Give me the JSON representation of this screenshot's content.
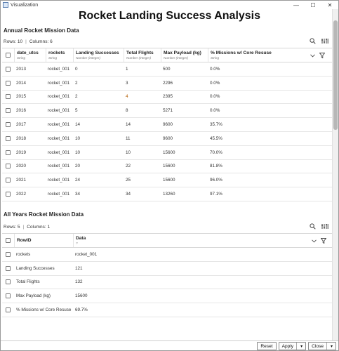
{
  "window": {
    "title": "Visualization",
    "minimize": "—",
    "maximize": "☐",
    "close": "✕"
  },
  "main_title": "Rocket Landing Success Analysis",
  "table1": {
    "title": "Annual Rocket Mission Data",
    "rows_label": "Rows: 10",
    "cols_label": "Columns: 6",
    "columns": [
      {
        "name": "date_utcs",
        "type": "String"
      },
      {
        "name": "rockets",
        "type": "String"
      },
      {
        "name": "Landing Successes",
        "type": "Number (Integer)"
      },
      {
        "name": "Total Flights",
        "type": "Number (Integer)"
      },
      {
        "name": "Max Payload (kg)",
        "type": "Number (Integer)"
      },
      {
        "name": "% Missions w/ Core Resuse",
        "type": "String"
      }
    ],
    "rows": [
      [
        "2013",
        "rocket_001",
        "0",
        "1",
        "500",
        "0.0%"
      ],
      [
        "2014",
        "rocket_001",
        "2",
        "3",
        "2296",
        "0.0%"
      ],
      [
        "2015",
        "rocket_001",
        "2",
        "4",
        "2395",
        "0.0%"
      ],
      [
        "2016",
        "rocket_001",
        "5",
        "8",
        "5271",
        "0.0%"
      ],
      [
        "2017",
        "rocket_001",
        "14",
        "14",
        "9600",
        "35.7%"
      ],
      [
        "2018",
        "rocket_001",
        "10",
        "11",
        "9600",
        "45.5%"
      ],
      [
        "2019",
        "rocket_001",
        "10",
        "10",
        "15600",
        "70.0%"
      ],
      [
        "2020",
        "rocket_001",
        "20",
        "22",
        "15600",
        "81.8%"
      ],
      [
        "2021",
        "rocket_001",
        "24",
        "25",
        "15600",
        "96.0%"
      ],
      [
        "2022",
        "rocket_001",
        "34",
        "34",
        "13260",
        "97.1%"
      ]
    ]
  },
  "table2": {
    "title": "All Years Rocket Mission Data",
    "rows_label": "Rows: 5",
    "cols_label": "Columns: 1",
    "columns": [
      {
        "name": "RowID",
        "type": ""
      },
      {
        "name": "Data",
        "type": "?"
      }
    ],
    "rows": [
      [
        "rockets",
        "rocket_001"
      ],
      [
        "Landing Successes",
        "121"
      ],
      [
        "Total Flights",
        "132"
      ],
      [
        "Max Payload (kg)",
        "15600"
      ],
      [
        "% Missions w/ Core Resuse",
        "69.7%"
      ]
    ]
  },
  "footer": {
    "reset": "Reset",
    "apply": "Apply",
    "close": "Close"
  },
  "colors": {
    "accent_orange": "#b35c00"
  }
}
